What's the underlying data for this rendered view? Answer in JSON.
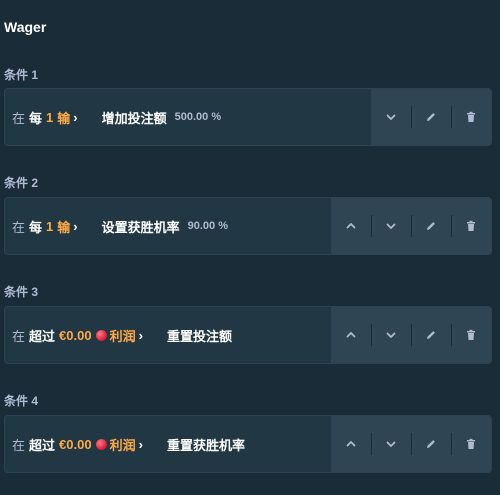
{
  "title": "Wager",
  "conditions": [
    {
      "label": "条件 1",
      "prefix": "在",
      "every": "每",
      "count": "1",
      "event": "输",
      "action": "增加投注额",
      "value": "500.00 %"
    },
    {
      "label": "条件 2",
      "prefix": "在",
      "every": "每",
      "count": "1",
      "event": "输",
      "action": "设置获胜机率",
      "value": "90.00 %"
    },
    {
      "label": "条件 3",
      "prefix": "在",
      "over": "超过",
      "amount": "€0.00",
      "profit": "利润",
      "action": "重置投注额"
    },
    {
      "label": "条件 4",
      "prefix": "在",
      "over": "超过",
      "amount": "€0.00",
      "profit": "利润",
      "action": "重置获胜机率"
    }
  ],
  "icons": {
    "up": "chevron-up-icon",
    "down": "chevron-down-icon",
    "edit": "pencil-icon",
    "delete": "trash-icon",
    "gem": "ruby-icon"
  },
  "colors": {
    "background": "#1a2c38",
    "card": "#213743",
    "button_panel": "#2f4553",
    "highlight": "#ffaa44"
  }
}
